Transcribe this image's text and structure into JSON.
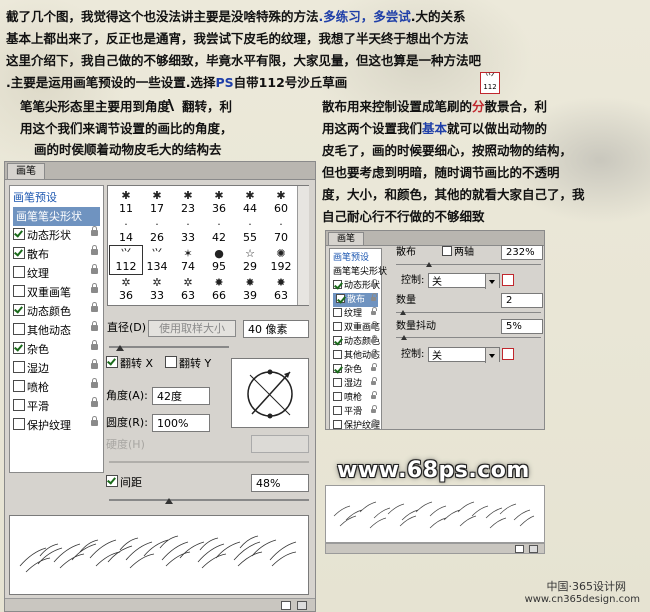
{
  "intro": {
    "line1a": "截了几个图，我觉得这个也没法讲主要是没啥特殊的方法",
    "line1b": ".多练习，多尝试",
    "line1c": ".大的关系",
    "line2": "基本上都出来了，反正也是通宵，我尝试下皮毛的纹理，我想了半天终于想出个方法",
    "line3a": "这里介绍下",
    "line3b": "，我自己做的不够细致，毕竟水平有限，大家见量，但这也算是一种方法吧",
    "line4a": ".主要是运用画笔预设的一些设置",
    "line4b": ".选择",
    "line4c": "PS",
    "line4d": "自带112号沙丘草画",
    "icon_num": "112"
  },
  "col_left": {
    "line1a": "笔笔尖形态里主要用到角度",
    "line1b": "翻转",
    "line1c": "，利",
    "line2": "用这个我们来调节设置的画比的角度，",
    "line3": "画的时侯顺着动物皮毛大的结构去"
  },
  "col_right": {
    "line1a": "散布用来控制设置成笔刷的",
    "line1b": "分",
    "line1c": "散景合，利",
    "line2a": "用这两个设置我们",
    "line2b": "基本",
    "line2c": "就可以做出动物的",
    "line3": "皮毛了，画的时候要细心，按照动物的结构，",
    "line4": "但也要考虑到明暗，随时调节画比的不透明",
    "line5": "度，大小，和颜色，其他的就看大家自己了，我",
    "line6": "自己耐心行不行做的不够细致"
  },
  "panel1": {
    "tab": "画笔",
    "items": [
      "画笔预设",
      "画笔笔尖形状",
      "动态形状",
      "散布",
      "纹理",
      "双重画笔",
      "动态颜色",
      "其他动态",
      "杂色",
      "湿边",
      "喷枪",
      "平滑",
      "保护纹理"
    ],
    "checked": [
      false,
      false,
      true,
      true,
      false,
      false,
      true,
      false,
      true,
      false,
      false,
      false,
      false
    ],
    "brush_sizes": [
      "11",
      "17",
      "23",
      "36",
      "44",
      "60",
      "14",
      "26",
      "33",
      "42",
      "55",
      "70",
      "112",
      "134",
      "74",
      "95",
      "29",
      "192",
      "36",
      "33",
      "63",
      "66",
      "39",
      "63"
    ],
    "brush_glyphs": [
      "✱",
      "✱",
      "✱",
      "✱",
      "✱",
      "✱",
      "·",
      "·",
      "·",
      "·",
      "·",
      "·",
      "⺍",
      "⺍",
      "✶",
      "●",
      "☆",
      "✺",
      "✲",
      "✲",
      "✲",
      "✸",
      "✸",
      "✸"
    ],
    "diameter_label": "直径(D)",
    "use_sample_btn": "使用取样大小",
    "diameter_value": "40 像素",
    "flip_x": "翻转 X",
    "flip_y": "翻转 Y",
    "angle_label": "角度(A):",
    "angle_value": "42度",
    "roundness_label": "圆度(R):",
    "roundness_value": "100%",
    "hardness_label": "硬度(H)",
    "spacing_label": "间距",
    "spacing_value": "48%"
  },
  "panel2": {
    "tab": "画笔",
    "items": [
      "画笔预设",
      "画笔笔尖形状",
      "动态形状",
      "散布",
      "纹理",
      "双重画笔",
      "动态颜色",
      "其他动态",
      "杂色",
      "湿边",
      "喷枪",
      "平滑",
      "保护纹理"
    ],
    "checked": [
      false,
      false,
      true,
      true,
      false,
      false,
      true,
      false,
      true,
      false,
      false,
      false,
      false
    ],
    "scatter_label": "散布",
    "both_axes": "两轴",
    "scatter_value": "232%",
    "control_label": "控制:",
    "control_value": "关",
    "count_label": "数量",
    "count_value": "2",
    "count_jitter_label": "数量抖动",
    "count_jitter_value": "5%",
    "control2_value": "关"
  },
  "brand": "www.68ps.com",
  "watermark1": "中国·365设计网",
  "watermark2": "www.cn365design.com"
}
